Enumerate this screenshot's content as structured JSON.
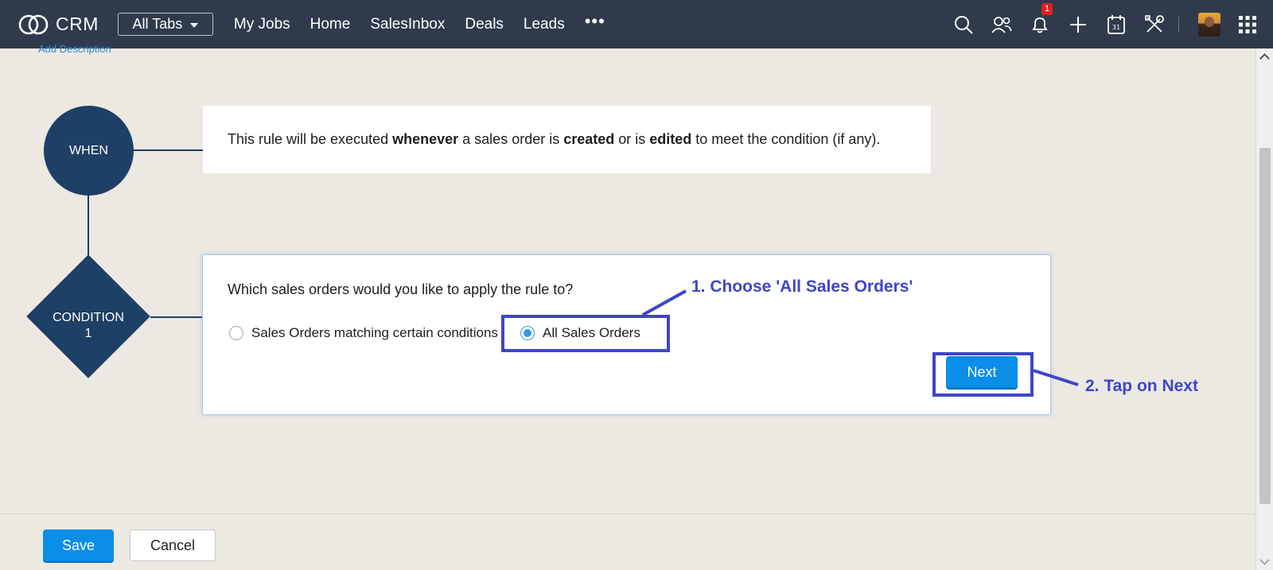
{
  "topbar": {
    "app_name": "CRM",
    "all_tabs_label": "All Tabs",
    "nav": [
      "My Jobs",
      "Home",
      "SalesInbox",
      "Deals",
      "Leads"
    ],
    "more_label": "•••",
    "notification_count": "1",
    "icons": [
      "search-icon",
      "contacts-icon",
      "bell-icon",
      "plus-icon",
      "calendar-icon",
      "tools-icon",
      "avatar",
      "apps-grid-icon"
    ]
  },
  "content": {
    "add_description": "Add Description",
    "when_label": "WHEN",
    "condition_label": "CONDITION",
    "condition_number": "1",
    "when_text": {
      "p1": "This rule will be executed ",
      "b1": "whenever",
      "p2": " a sales order is ",
      "b2": "created",
      "p3": " or is ",
      "b3": "edited",
      "p4": " to meet the condition (if any)."
    },
    "question": "Which sales orders would you like to apply the rule to?",
    "options": [
      "Sales Orders matching certain conditions",
      "All Sales Orders"
    ],
    "selected_option": "All Sales Orders",
    "next_label": "Next"
  },
  "annotations": {
    "step1": "1. Choose 'All Sales Orders'",
    "step2": "2. Tap on Next",
    "color": "#3e45c8"
  },
  "footer": {
    "save_label": "Save",
    "cancel_label": "Cancel"
  },
  "colors": {
    "topbar_bg": "#2f3b4c",
    "node_fill": "#1e3f66",
    "primary_button": "#0a8ee8",
    "page_bg": "#ece9e2"
  }
}
